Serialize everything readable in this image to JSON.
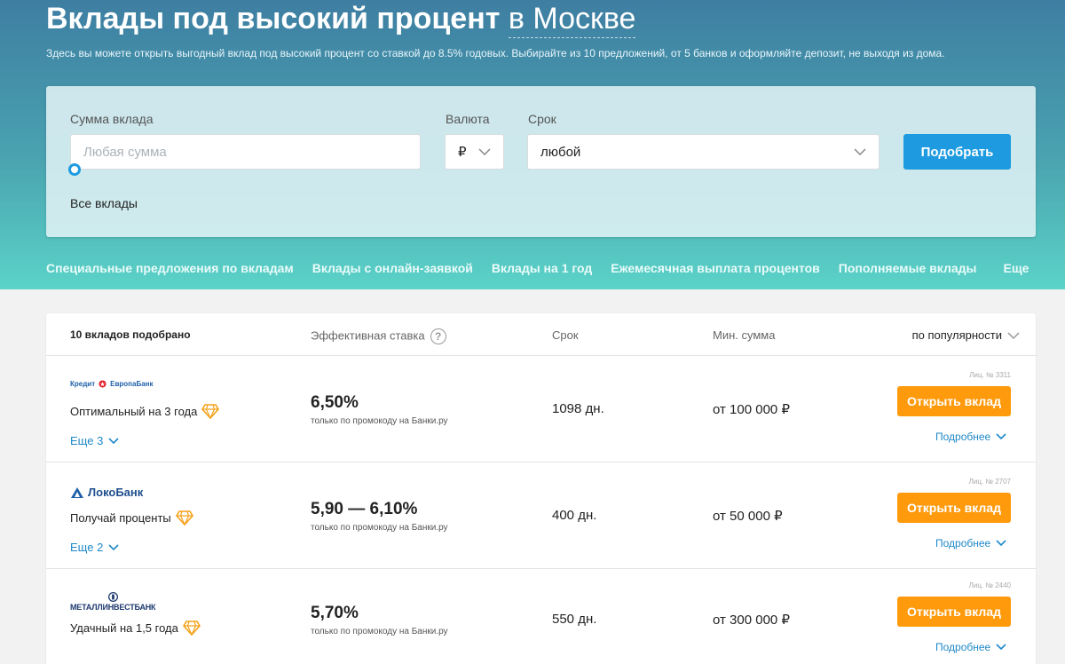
{
  "header": {
    "title_bold": "Вклады под высокий процент",
    "title_city": "в Москве",
    "subtitle": "Здесь вы можете открыть выгодный вклад под высокий процент со ставкой до 8.5% годовых. Выбирайте из 10 предложений, от 5 банков и оформляйте депозит, не выходя из дома."
  },
  "search": {
    "amount_label": "Сумма вклада",
    "amount_placeholder": "Любая сумма",
    "currency_label": "Валюта",
    "currency_value": "₽",
    "term_label": "Срок",
    "term_value": "любой",
    "submit_label": "Подобрать",
    "all_link": "Все вклады"
  },
  "tabs": [
    "Специальные предложения по вкладам",
    "Вклады с онлайн-заявкой",
    "Вклады на 1 год",
    "Ежемесячная выплата процентов",
    "Пополняемые вклады",
    "Еще"
  ],
  "results": {
    "count": "10 вкладов подобрано",
    "col_rate": "Эффективная ставка",
    "col_term": "Срок",
    "col_min": "Мин. сумма",
    "sort": "по популярности",
    "help": "?",
    "rows": [
      {
        "bank_part1": "Кредит",
        "bank_part2": "ЕвропаБанк",
        "promo": "Оптимальный на 3 года",
        "more": "Еще 3",
        "rate": "6,50%",
        "rate_note": "только по промокоду на Банки.ру",
        "term": "1098 дн.",
        "min": "от 100 000 ₽",
        "license": "Лиц. № 3311",
        "open": "Открыть вклад",
        "details": "Подробнее"
      },
      {
        "bank": "ЛокоБанк",
        "promo": "Получай проценты",
        "more": "Еще 2",
        "rate": "5,90 — 6,10%",
        "rate_note": "только по промокоду на Банки.ру",
        "term": "400 дн.",
        "min": "от 50 000 ₽",
        "license": "Лиц. № 2707",
        "open": "Открыть вклад",
        "details": "Подробнее"
      },
      {
        "bank": "МЕТАЛЛИНВЕСТБАНК",
        "promo": "Удачный на 1,5 года",
        "rate": "5,70%",
        "rate_note": "только по промокоду на Банки.ру",
        "term": "550 дн.",
        "min": "от 300 000 ₽",
        "license": "Лиц. № 2440",
        "open": "Открыть вклад",
        "details": "Подробнее"
      }
    ]
  },
  "colors": {
    "primary_blue": "#1e9be0",
    "accent_orange": "#ff9a0c",
    "link_blue": "#1e88c8"
  }
}
